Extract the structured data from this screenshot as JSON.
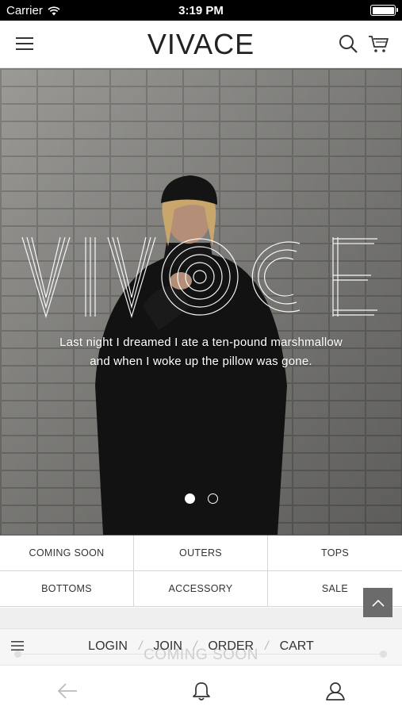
{
  "status_bar": {
    "carrier": "Carrier",
    "time": "3:19 PM",
    "wifi_icon": "wifi-icon",
    "battery_icon": "battery-icon"
  },
  "header": {
    "brand": "VIVACE",
    "menu_icon": "hamburger-menu-icon",
    "search_icon": "search-icon",
    "cart_icon": "cart-icon"
  },
  "hero": {
    "logo_art_icon": "vivace-wordmark-art",
    "caption_line1": "Last night I dreamed I ate a ten-pound marshmallow",
    "caption_line2": "and when I woke up the pillow was gone.",
    "slides_total": 2,
    "active_slide": 1
  },
  "categories": [
    {
      "label": "COMING SOON"
    },
    {
      "label": "OUTERS"
    },
    {
      "label": "TOPS"
    },
    {
      "label": "BOTTOMS"
    },
    {
      "label": "ACCESSORY"
    },
    {
      "label": "SALE"
    }
  ],
  "footer": {
    "ghost_title": "COMING SOON",
    "list_icon": "list-icon",
    "links": {
      "login": "LOGIN",
      "join": "JOIN",
      "order": "ORDER",
      "cart": "CART",
      "separator": "/"
    }
  },
  "scroll_top_icon": "chevron-up-icon",
  "tab_bar": {
    "back_icon": "back-arrow-icon",
    "notification_icon": "bell-icon",
    "profile_icon": "user-icon"
  },
  "colors": {
    "status_bar": "#000000",
    "scroll_top_button": "#6b6b6b",
    "text": "#222222"
  }
}
